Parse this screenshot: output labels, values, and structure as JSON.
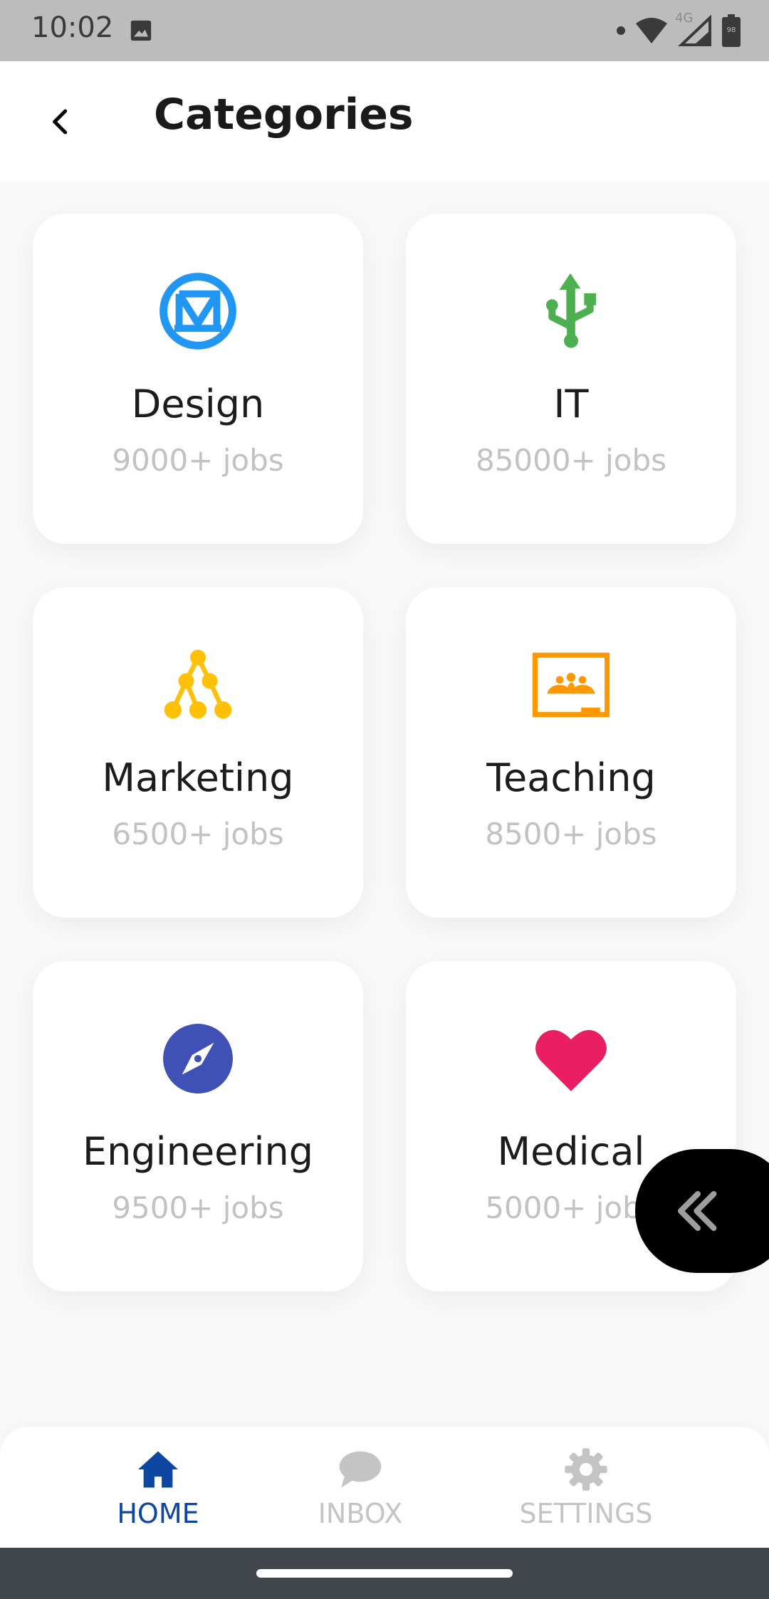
{
  "status_bar": {
    "time": "10:02",
    "network": "4G",
    "battery": "98"
  },
  "header": {
    "title": "Categories"
  },
  "categories": [
    {
      "name": "Design",
      "count": "9000+ jobs",
      "icon": "design-logo-icon",
      "color": "#2196f3"
    },
    {
      "name": "IT",
      "count": "85000+ jobs",
      "icon": "usb-icon",
      "color": "#4caf50"
    },
    {
      "name": "Marketing",
      "count": "6500+ jobs",
      "icon": "network-tree-icon",
      "color": "#ffc107"
    },
    {
      "name": "Teaching",
      "count": "8500+ jobs",
      "icon": "classroom-icon",
      "color": "#ff9800"
    },
    {
      "name": "Engineering",
      "count": "9500+ jobs",
      "icon": "compass-icon",
      "color": "#3f51b5"
    },
    {
      "name": "Medical",
      "count": "5000+ jobs",
      "icon": "heart-icon",
      "color": "#e91e63"
    }
  ],
  "bottom_nav": {
    "items": [
      {
        "label": "HOME",
        "icon": "home-icon",
        "active": true
      },
      {
        "label": "INBOX",
        "icon": "chat-bubble-icon",
        "active": false
      },
      {
        "label": "SETTINGS",
        "icon": "gear-icon",
        "active": false
      }
    ],
    "active_color": "#0d47a1",
    "inactive_color": "#c4c4c4"
  },
  "float_button": {
    "icon": "double-chevron-left-icon"
  }
}
